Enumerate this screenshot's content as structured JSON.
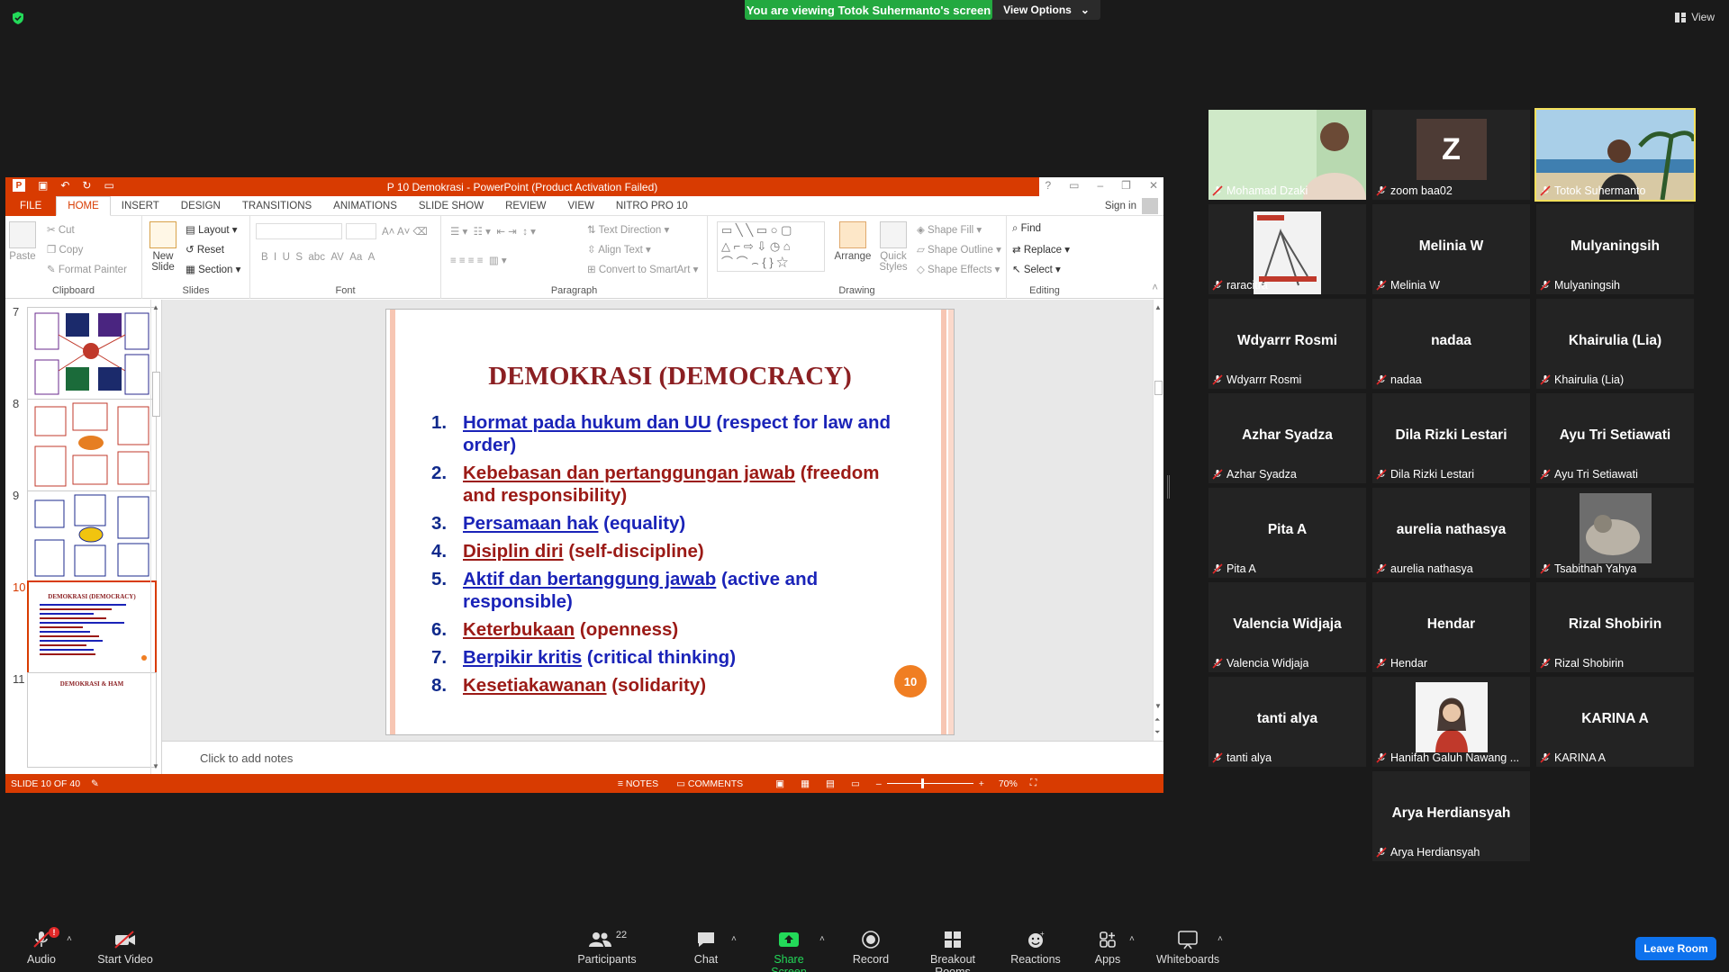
{
  "zoom": {
    "viewing_banner": "You are viewing Totok Suhermanto's screen",
    "view_options": "View Options",
    "view_label": "View",
    "leave_button": "Leave Room"
  },
  "ppt": {
    "title": "P 10 Demokrasi -  PowerPoint (Product Activation Failed)",
    "tabs": [
      "FILE",
      "HOME",
      "INSERT",
      "DESIGN",
      "TRANSITIONS",
      "ANIMATIONS",
      "SLIDE SHOW",
      "REVIEW",
      "VIEW",
      "NITRO PRO 10"
    ],
    "sign_in": "Sign in",
    "ribbon": {
      "paste": "Paste",
      "cut": "Cut",
      "copy": "Copy",
      "format_painter": "Format Painter",
      "clipboard": "Clipboard",
      "new_slide": "New Slide",
      "layout": "Layout",
      "reset": "Reset",
      "section": "Section",
      "slides": "Slides",
      "font": "Font",
      "text_direction": "Text Direction",
      "align_text": "Align Text",
      "convert_smartart": "Convert to SmartArt",
      "paragraph": "Paragraph",
      "arrange": "Arrange",
      "quick_styles": "Quick Styles",
      "shape_fill": "Shape Fill",
      "shape_outline": "Shape Outline",
      "shape_effects": "Shape Effects",
      "drawing": "Drawing",
      "find": "Find",
      "replace": "Replace",
      "select": "Select",
      "editing": "Editing"
    },
    "thumb_numbers": [
      "7",
      "8",
      "9",
      "10",
      "11"
    ],
    "thumb10_title": "DEMOKRASI (DEMOCRACY)",
    "thumb11_title": "DEMOKRASI & HAM",
    "slide_title": "DEMOKRASI (DEMOCRACY)",
    "slide_items": [
      {
        "n": "1.",
        "main": "Hormat pada hukum dan UU",
        "rest": " (respect for law and order)",
        "color": "blue"
      },
      {
        "n": "2.",
        "main": "Kebebasan dan pertanggungan jawab",
        "rest": " (freedom and responsibility)",
        "color": "red"
      },
      {
        "n": "3.",
        "main": "Persamaan hak",
        "rest": " (equality)",
        "color": "blue"
      },
      {
        "n": "4.",
        "main": "Disiplin diri",
        "rest": " (self-discipline)",
        "color": "red"
      },
      {
        "n": "5.",
        "main": "Aktif dan bertanggung jawab",
        "rest": " (active and responsible)",
        "color": "blue"
      },
      {
        "n": "6.",
        "main": "Keterbukaan",
        "rest": " (openness)",
        "color": "red"
      },
      {
        "n": "7.",
        "main": "Berpikir kritis",
        "rest": " (critical thinking)",
        "color": "blue"
      },
      {
        "n": "8.",
        "main": "Kesetiakawanan",
        "rest": " (solidarity)",
        "color": "red"
      }
    ],
    "page_badge": "10",
    "notes_placeholder": "Click to add notes",
    "status_slide": "SLIDE 10 OF 40",
    "status_notes": "NOTES",
    "status_comments": "COMMENTS",
    "zoom_level": "70%"
  },
  "participants": [
    {
      "name": "Mohamad Dzaki",
      "display": "",
      "video": true
    },
    {
      "name": "zoom baa02",
      "display": "Z",
      "video": false
    },
    {
      "name": "Totok Suhermanto",
      "display": "",
      "video": true,
      "speaking": true
    },
    {
      "name": "raracitra",
      "display": "",
      "video": true
    },
    {
      "name": "Melinia W",
      "display": "Melinia W",
      "video": false
    },
    {
      "name": "Mulyaningsih",
      "display": "Mulyaningsih",
      "video": false
    },
    {
      "name": "Wdyarrr Rosmi",
      "display": "Wdyarrr Rosmi",
      "video": false
    },
    {
      "name": "nadaa",
      "display": "nadaa",
      "video": false
    },
    {
      "name": "Khairulia (Lia)",
      "display": "Khairulia (Lia)",
      "video": false
    },
    {
      "name": "Azhar Syadza",
      "display": "Azhar Syadza",
      "video": false
    },
    {
      "name": "Dila Rizki Lestari",
      "display": "Dila Rizki Lestari",
      "video": false
    },
    {
      "name": "Ayu Tri Setiawati",
      "display": "Ayu Tri Setiawati",
      "video": false
    },
    {
      "name": "Pita A",
      "display": "Pita A",
      "video": false
    },
    {
      "name": "aurelia nathasya",
      "display": "aurelia nathasya",
      "video": false
    },
    {
      "name": "Tsabithah Yahya",
      "display": "",
      "video": true
    },
    {
      "name": "Valencia Widjaja",
      "display": "Valencia Widjaja",
      "video": false
    },
    {
      "name": "Hendar",
      "display": "Hendar",
      "video": false
    },
    {
      "name": "Rizal Shobirin",
      "display": "Rizal Shobirin",
      "video": false
    },
    {
      "name": "tanti alya",
      "display": "tanti alya",
      "video": false
    },
    {
      "name": "Hanifah Galuh Nawang ...",
      "display": "",
      "video": true
    },
    {
      "name": "KARINA A",
      "display": "KARINA A",
      "video": false
    },
    {
      "name": "Arya Herdiansyah",
      "display": "Arya Herdiansyah",
      "video": false
    }
  ],
  "toolbar": {
    "audio": "Audio",
    "start_video": "Start Video",
    "participants": "Participants",
    "participants_count": "22",
    "chat": "Chat",
    "share_screen": "Share Screen",
    "record": "Record",
    "breakout_rooms": "Breakout Rooms",
    "reactions": "Reactions",
    "apps": "Apps",
    "whiteboards": "Whiteboards",
    "audio_badge": "!"
  },
  "colors": {
    "zoom_green": "#23a940",
    "ppt_orange": "#d83b01",
    "slide_blue": "#1a23b8",
    "slide_red": "#9b1a16",
    "leave_blue": "#0e72ed",
    "speaker_yellow": "#f3e05c"
  }
}
